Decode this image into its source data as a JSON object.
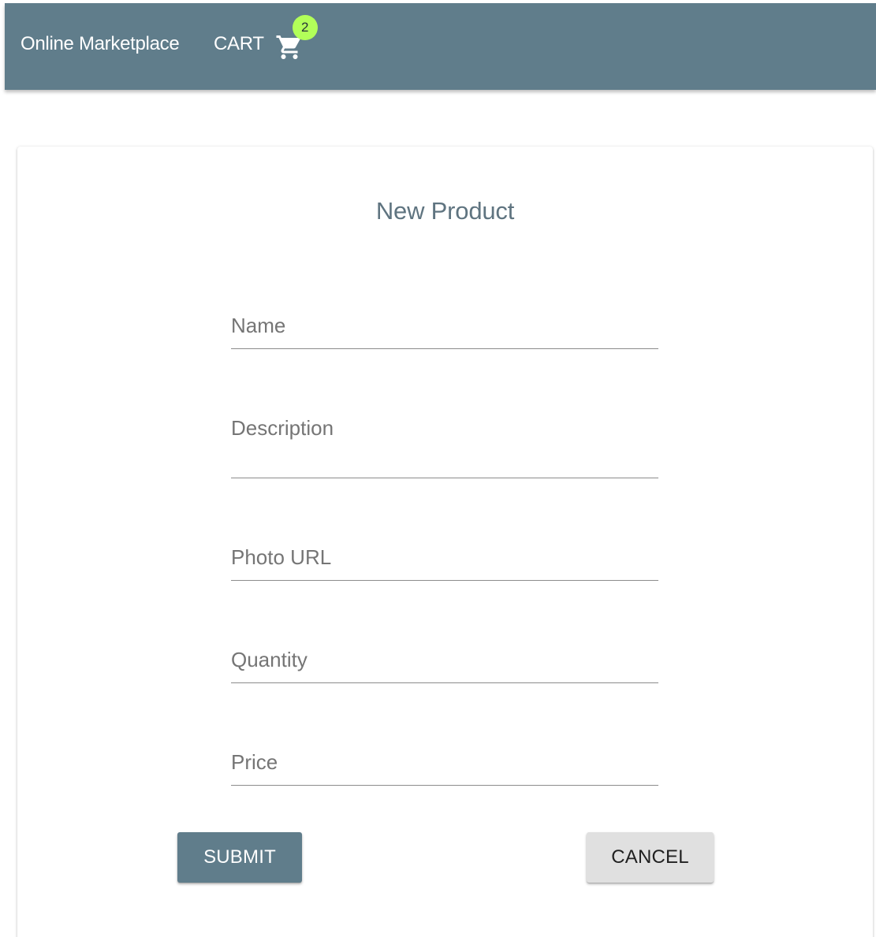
{
  "appbar": {
    "brand": "Online Marketplace",
    "cart_label": "CART",
    "cart_count": "2",
    "cart_icon": "shopping-cart-icon",
    "background_color": "#607d8b",
    "badge_color": "#b2ff59"
  },
  "form": {
    "title": "New Product",
    "fields": {
      "name": {
        "label": "Name",
        "value": ""
      },
      "description": {
        "label": "Description",
        "value": ""
      },
      "photo_url": {
        "label": "Photo URL",
        "value": ""
      },
      "quantity": {
        "label": "Quantity",
        "value": ""
      },
      "price": {
        "label": "Price",
        "value": ""
      }
    },
    "submit_label": "SUBMIT",
    "cancel_label": "CANCEL",
    "submit_color": "#607d8b",
    "cancel_color": "#e0e0e0"
  }
}
